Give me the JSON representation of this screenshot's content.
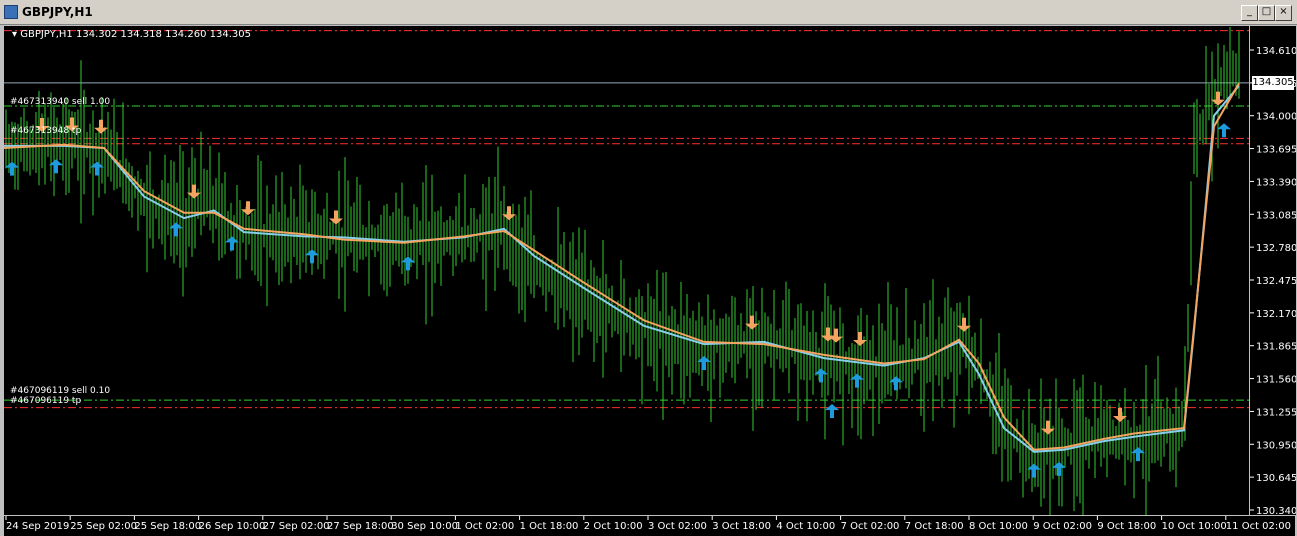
{
  "window": {
    "title": "GBPJPY,H1",
    "minimize_label": "_",
    "restore_label": "□",
    "close_label": "×"
  },
  "chart_info": {
    "symbol": "GBPJPY,H1",
    "open": "134.302",
    "high": "134.318",
    "low": "134.260",
    "close": "134.305"
  },
  "order_labels": [
    {
      "text": "#467313940 sell 1.00"
    },
    {
      "text": "#467313948 tp"
    },
    {
      "text": "#467096119 sell 0.10"
    },
    {
      "text": "#467096119 tp"
    }
  ],
  "colors": {
    "background": "#000000",
    "bars": "#32cd32",
    "ma_fast": "#f4a460",
    "ma_slow": "#87ceeb",
    "arrow_up": "#1e9bdc",
    "arrow_down": "#f4a460",
    "tp_line": "#ff3030",
    "sell_line": "#32cd32",
    "bid_line": "#9aa9b8"
  },
  "icons": {
    "up": "arrow-up-icon",
    "down": "arrow-down-icon"
  },
  "chart_data": {
    "type": "candlestick-bars",
    "symbol": "GBPJPY",
    "timeframe": "H1",
    "current_price": "134.305",
    "ylim": [
      130.34,
      134.61
    ],
    "price_ticks": [
      "134.610",
      "134.305",
      "134.000",
      "133.695",
      "133.390",
      "133.085",
      "132.780",
      "132.475",
      "132.170",
      "131.865",
      "131.560",
      "131.255",
      "130.950",
      "130.645",
      "130.340"
    ],
    "time_labels": [
      "24 Sep 2019",
      "25 Sep 02:00",
      "25 Sep 18:00",
      "26 Sep 10:00",
      "27 Sep 02:00",
      "27 Sep 18:00",
      "30 Sep 10:00",
      "1 Oct 02:00",
      "1 Oct 18:00",
      "2 Oct 10:00",
      "3 Oct 02:00",
      "3 Oct 18:00",
      "4 Oct 10:00",
      "7 Oct 02:00",
      "7 Oct 18:00",
      "8 Oct 10:00",
      "9 Oct 02:00",
      "9 Oct 18:00",
      "10 Oct 10:00",
      "11 Oct 02:00"
    ],
    "horizontal_levels": [
      {
        "name": "tp-top",
        "price": 134.79,
        "kind": "tp"
      },
      {
        "name": "sell-1.00",
        "price": 134.09,
        "kind": "sell"
      },
      {
        "name": "tp-1",
        "price": 133.79,
        "kind": "tp"
      },
      {
        "name": "tp-2",
        "price": 133.74,
        "kind": "tp"
      },
      {
        "name": "sell-0.10",
        "price": 131.36,
        "kind": "sell"
      },
      {
        "name": "tp-3",
        "price": 131.29,
        "kind": "tp"
      },
      {
        "name": "bid",
        "price": 134.305,
        "kind": "bid"
      }
    ],
    "price_path": [
      [
        0,
        133.7
      ],
      [
        60,
        133.75
      ],
      [
        100,
        133.72
      ],
      [
        140,
        133.2
      ],
      [
        180,
        133.05
      ],
      [
        200,
        133.25
      ],
      [
        230,
        132.95
      ],
      [
        260,
        132.88
      ],
      [
        300,
        132.9
      ],
      [
        330,
        132.88
      ],
      [
        360,
        132.85
      ],
      [
        400,
        132.83
      ],
      [
        440,
        132.85
      ],
      [
        470,
        132.9
      ],
      [
        500,
        132.97
      ],
      [
        520,
        132.65
      ],
      [
        560,
        132.4
      ],
      [
        600,
        132.2
      ],
      [
        660,
        131.95
      ],
      [
        700,
        131.85
      ],
      [
        740,
        131.9
      ],
      [
        780,
        131.88
      ],
      [
        810,
        131.75
      ],
      [
        840,
        131.7
      ],
      [
        880,
        131.68
      ],
      [
        910,
        131.75
      ],
      [
        940,
        131.8
      ],
      [
        960,
        131.9
      ],
      [
        990,
        131.35
      ],
      [
        1020,
        130.85
      ],
      [
        1050,
        130.9
      ],
      [
        1080,
        130.95
      ],
      [
        1110,
        131.05
      ],
      [
        1140,
        131.0
      ],
      [
        1180,
        131.1
      ],
      [
        1190,
        133.7
      ],
      [
        1210,
        134.2
      ],
      [
        1225,
        134.45
      ],
      [
        1232,
        134.4
      ]
    ],
    "ma_fast": [
      [
        0,
        133.7
      ],
      [
        60,
        133.73
      ],
      [
        100,
        133.7
      ],
      [
        140,
        133.3
      ],
      [
        180,
        133.1
      ],
      [
        210,
        133.1
      ],
      [
        240,
        132.95
      ],
      [
        300,
        132.9
      ],
      [
        340,
        132.85
      ],
      [
        400,
        132.82
      ],
      [
        460,
        132.88
      ],
      [
        500,
        132.93
      ],
      [
        530,
        132.75
      ],
      [
        580,
        132.45
      ],
      [
        640,
        132.1
      ],
      [
        700,
        131.9
      ],
      [
        760,
        131.88
      ],
      [
        820,
        131.78
      ],
      [
        880,
        131.7
      ],
      [
        920,
        131.74
      ],
      [
        955,
        131.92
      ],
      [
        975,
        131.7
      ],
      [
        1000,
        131.2
      ],
      [
        1030,
        130.9
      ],
      [
        1060,
        130.92
      ],
      [
        1100,
        131.0
      ],
      [
        1130,
        131.05
      ],
      [
        1180,
        131.1
      ],
      [
        1195,
        132.5
      ],
      [
        1210,
        133.9
      ],
      [
        1235,
        134.3
      ]
    ],
    "ma_slow": [
      [
        0,
        133.72
      ],
      [
        60,
        133.72
      ],
      [
        100,
        133.7
      ],
      [
        140,
        133.25
      ],
      [
        180,
        133.05
      ],
      [
        210,
        133.12
      ],
      [
        240,
        132.92
      ],
      [
        300,
        132.88
      ],
      [
        340,
        132.87
      ],
      [
        400,
        132.83
      ],
      [
        460,
        132.87
      ],
      [
        500,
        132.95
      ],
      [
        530,
        132.7
      ],
      [
        580,
        132.4
      ],
      [
        640,
        132.05
      ],
      [
        700,
        131.88
      ],
      [
        760,
        131.9
      ],
      [
        820,
        131.75
      ],
      [
        880,
        131.68
      ],
      [
        920,
        131.75
      ],
      [
        955,
        131.9
      ],
      [
        975,
        131.6
      ],
      [
        1000,
        131.1
      ],
      [
        1030,
        130.88
      ],
      [
        1060,
        130.9
      ],
      [
        1100,
        130.98
      ],
      [
        1130,
        131.02
      ],
      [
        1180,
        131.08
      ],
      [
        1190,
        132.0
      ],
      [
        1210,
        134.0
      ],
      [
        1235,
        134.28
      ]
    ],
    "signals": [
      {
        "x": 8,
        "type": "up"
      },
      {
        "x": 38,
        "type": "down"
      },
      {
        "x": 52,
        "type": "up"
      },
      {
        "x": 68,
        "type": "down"
      },
      {
        "x": 93,
        "type": "up"
      },
      {
        "x": 97,
        "type": "down"
      },
      {
        "x": 172,
        "type": "up"
      },
      {
        "x": 190,
        "type": "down"
      },
      {
        "x": 228,
        "type": "up"
      },
      {
        "x": 244,
        "type": "down"
      },
      {
        "x": 308,
        "type": "up"
      },
      {
        "x": 332,
        "type": "down"
      },
      {
        "x": 404,
        "type": "up"
      },
      {
        "x": 505,
        "type": "down"
      },
      {
        "x": 700,
        "type": "up"
      },
      {
        "x": 748,
        "type": "down"
      },
      {
        "x": 817,
        "type": "up"
      },
      {
        "x": 824,
        "type": "down"
      },
      {
        "x": 832,
        "type": "down"
      },
      {
        "x": 828,
        "type": "up2"
      },
      {
        "x": 853,
        "type": "up"
      },
      {
        "x": 856,
        "type": "down"
      },
      {
        "x": 892,
        "type": "up"
      },
      {
        "x": 960,
        "type": "down"
      },
      {
        "x": 1030,
        "type": "up"
      },
      {
        "x": 1044,
        "type": "down"
      },
      {
        "x": 1055,
        "type": "up"
      },
      {
        "x": 1116,
        "type": "down"
      },
      {
        "x": 1134,
        "type": "up"
      },
      {
        "x": 1214,
        "type": "down"
      },
      {
        "x": 1220,
        "type": "up"
      }
    ]
  }
}
